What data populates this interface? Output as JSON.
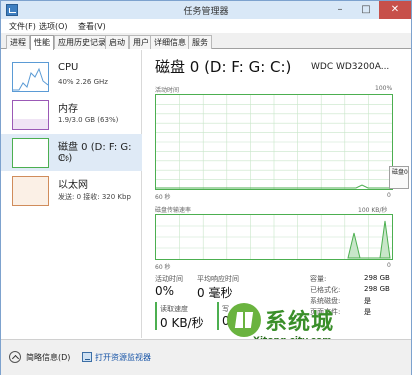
{
  "window": {
    "title": "任务管理器",
    "minimize": "–",
    "maximize": "□",
    "close": "✕"
  },
  "menu": [
    "文件(F)",
    "选项(O)",
    "查看(V)"
  ],
  "tabs": [
    "进程",
    "性能",
    "应用历史记录",
    "启动",
    "用户",
    "详细信息",
    "服务"
  ],
  "active_tab": "性能",
  "sidebar": {
    "items": [
      {
        "title": "CPU",
        "sub": "40%  2.26 GHz",
        "icon": "cpu-graph"
      },
      {
        "title": "内存",
        "sub": "1.9/3.0 GB (63%)",
        "icon": "memory-graph"
      },
      {
        "title": "磁盘 0 (D: F: G: C:)",
        "sub": "0%",
        "icon": "disk-graph",
        "selected": true
      },
      {
        "title": "以太网",
        "sub": "发送: 0 接收: 320 Kbp",
        "icon": "ethernet-graph"
      }
    ]
  },
  "main": {
    "title": "磁盘 0 (D: F: G: C:)",
    "model": "WDC WD3200A...",
    "activity_label": "活动时间",
    "activity_max": "100%",
    "activity_time": "60 秒",
    "activity_min": "0",
    "transfer_label": "磁盘传输速率",
    "transfer_max": "100 KB/秒",
    "transfer_time": "60 秒",
    "transfer_min": "0",
    "tooltip": "磁盘​0\n比",
    "stats": {
      "active_time_label": "活动时间",
      "active_time_value": "0%",
      "avg_response_label": "平均响应时间",
      "avg_response_value": "0 毫秒",
      "read_label": "读取速度",
      "read_value": "0 KB/秒",
      "write_label": "写",
      "write_value": "0"
    },
    "info": [
      {
        "key": "容量:",
        "value": "298 GB"
      },
      {
        "key": "已格式化:",
        "value": "298 GB"
      },
      {
        "key": "系统磁盘:",
        "value": "是"
      },
      {
        "key": "页面文件:",
        "value": "是"
      }
    ]
  },
  "footer": {
    "summary": "简略信息(D)",
    "resmon": "打开资源监视器"
  },
  "watermark": {
    "brand": "系统城",
    "url": "Xitong city.com"
  }
}
